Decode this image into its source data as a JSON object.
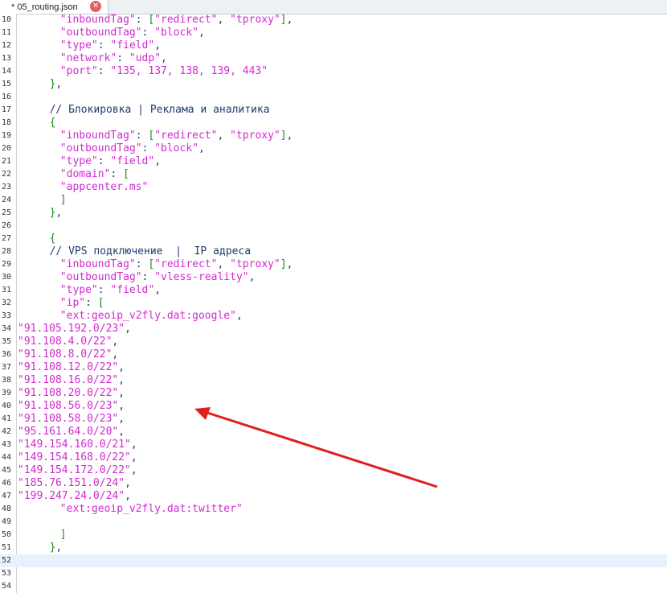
{
  "tab": {
    "title": "* 05_routing.json",
    "close_icon": "close-icon"
  },
  "lines": [
    {
      "n": "10",
      "indent": "        ",
      "tokens": [
        [
          "s",
          "\"inboundTag\""
        ],
        [
          "k",
          ": "
        ],
        [
          "p",
          "["
        ],
        [
          "s",
          "\"redirect\""
        ],
        [
          "k",
          ", "
        ],
        [
          "s",
          "\"tproxy\""
        ],
        [
          "p",
          "]"
        ],
        [
          "k",
          ","
        ]
      ]
    },
    {
      "n": "11",
      "indent": "        ",
      "tokens": [
        [
          "s",
          "\"outboundTag\""
        ],
        [
          "k",
          ": "
        ],
        [
          "s",
          "\"block\""
        ],
        [
          "k",
          ","
        ]
      ]
    },
    {
      "n": "12",
      "indent": "        ",
      "tokens": [
        [
          "s",
          "\"type\""
        ],
        [
          "k",
          ": "
        ],
        [
          "s",
          "\"field\""
        ],
        [
          "k",
          ","
        ]
      ]
    },
    {
      "n": "13",
      "indent": "        ",
      "tokens": [
        [
          "s",
          "\"network\""
        ],
        [
          "k",
          ": "
        ],
        [
          "s",
          "\"udp\""
        ],
        [
          "k",
          ","
        ]
      ]
    },
    {
      "n": "14",
      "indent": "        ",
      "tokens": [
        [
          "s",
          "\"port\""
        ],
        [
          "k",
          ": "
        ],
        [
          "s",
          "\"135, 137, 138, 139, 443\""
        ]
      ]
    },
    {
      "n": "15",
      "indent": "      ",
      "tokens": [
        [
          "p",
          "}"
        ],
        [
          "k",
          ","
        ]
      ]
    },
    {
      "n": "16",
      "indent": "",
      "tokens": []
    },
    {
      "n": "17",
      "indent": "      ",
      "tokens": [
        [
          "c",
          "// Блокировка | Реклама и аналитика"
        ]
      ]
    },
    {
      "n": "18",
      "indent": "      ",
      "tokens": [
        [
          "p",
          "{"
        ]
      ]
    },
    {
      "n": "19",
      "indent": "        ",
      "tokens": [
        [
          "s",
          "\"inboundTag\""
        ],
        [
          "k",
          ": "
        ],
        [
          "p",
          "["
        ],
        [
          "s",
          "\"redirect\""
        ],
        [
          "k",
          ", "
        ],
        [
          "s",
          "\"tproxy\""
        ],
        [
          "p",
          "]"
        ],
        [
          "k",
          ","
        ]
      ]
    },
    {
      "n": "20",
      "indent": "        ",
      "tokens": [
        [
          "s",
          "\"outboundTag\""
        ],
        [
          "k",
          ": "
        ],
        [
          "s",
          "\"block\""
        ],
        [
          "k",
          ","
        ]
      ]
    },
    {
      "n": "21",
      "indent": "        ",
      "tokens": [
        [
          "s",
          "\"type\""
        ],
        [
          "k",
          ": "
        ],
        [
          "s",
          "\"field\""
        ],
        [
          "k",
          ","
        ]
      ]
    },
    {
      "n": "22",
      "indent": "        ",
      "tokens": [
        [
          "s",
          "\"domain\""
        ],
        [
          "k",
          ": "
        ],
        [
          "p",
          "["
        ]
      ]
    },
    {
      "n": "23",
      "indent": "        ",
      "tokens": [
        [
          "s",
          "\"appcenter.ms\""
        ]
      ]
    },
    {
      "n": "24",
      "indent": "        ",
      "tokens": [
        [
          "p",
          "]"
        ]
      ]
    },
    {
      "n": "25",
      "indent": "      ",
      "tokens": [
        [
          "p",
          "}"
        ],
        [
          "k",
          ","
        ]
      ]
    },
    {
      "n": "26",
      "indent": "",
      "tokens": []
    },
    {
      "n": "27",
      "indent": "      ",
      "tokens": [
        [
          "p",
          "{"
        ]
      ]
    },
    {
      "n": "28",
      "indent": "      ",
      "tokens": [
        [
          "c",
          "// VPS подключение  |  IP адреса"
        ]
      ]
    },
    {
      "n": "29",
      "indent": "        ",
      "tokens": [
        [
          "s",
          "\"inboundTag\""
        ],
        [
          "k",
          ": "
        ],
        [
          "p",
          "["
        ],
        [
          "s",
          "\"redirect\""
        ],
        [
          "k",
          ", "
        ],
        [
          "s",
          "\"tproxy\""
        ],
        [
          "p",
          "]"
        ],
        [
          "k",
          ","
        ]
      ]
    },
    {
      "n": "30",
      "indent": "        ",
      "tokens": [
        [
          "s",
          "\"outboundTag\""
        ],
        [
          "k",
          ": "
        ],
        [
          "s",
          "\"vless-reality\""
        ],
        [
          "k",
          ","
        ]
      ]
    },
    {
      "n": "31",
      "indent": "        ",
      "tokens": [
        [
          "s",
          "\"type\""
        ],
        [
          "k",
          ": "
        ],
        [
          "s",
          "\"field\""
        ],
        [
          "k",
          ","
        ]
      ]
    },
    {
      "n": "32",
      "indent": "        ",
      "tokens": [
        [
          "s",
          "\"ip\""
        ],
        [
          "k",
          ": "
        ],
        [
          "p",
          "["
        ]
      ]
    },
    {
      "n": "33",
      "indent": "        ",
      "tokens": [
        [
          "s",
          "\"ext:geoip_v2fly.dat:google\""
        ],
        [
          "k",
          ","
        ]
      ]
    },
    {
      "n": "34",
      "indent": "",
      "tokens": [
        [
          "s",
          "\"91.105.192.0/23\""
        ],
        [
          "k",
          ","
        ]
      ]
    },
    {
      "n": "35",
      "indent": "",
      "tokens": [
        [
          "s",
          "\"91.108.4.0/22\""
        ],
        [
          "k",
          ","
        ]
      ]
    },
    {
      "n": "36",
      "indent": "",
      "tokens": [
        [
          "s",
          "\"91.108.8.0/22\""
        ],
        [
          "k",
          ","
        ]
      ]
    },
    {
      "n": "37",
      "indent": "",
      "tokens": [
        [
          "s",
          "\"91.108.12.0/22\""
        ],
        [
          "k",
          ","
        ]
      ]
    },
    {
      "n": "38",
      "indent": "",
      "tokens": [
        [
          "s",
          "\"91.108.16.0/22\""
        ],
        [
          "k",
          ","
        ]
      ]
    },
    {
      "n": "39",
      "indent": "",
      "tokens": [
        [
          "s",
          "\"91.108.20.0/22\""
        ],
        [
          "k",
          ","
        ]
      ]
    },
    {
      "n": "40",
      "indent": "",
      "tokens": [
        [
          "s",
          "\"91.108.56.0/23\""
        ],
        [
          "k",
          ","
        ]
      ]
    },
    {
      "n": "41",
      "indent": "",
      "tokens": [
        [
          "s",
          "\"91.108.58.0/23\""
        ],
        [
          "k",
          ","
        ]
      ]
    },
    {
      "n": "42",
      "indent": "",
      "tokens": [
        [
          "s",
          "\"95.161.64.0/20\""
        ],
        [
          "k",
          ","
        ]
      ]
    },
    {
      "n": "43",
      "indent": "",
      "tokens": [
        [
          "s",
          "\"149.154.160.0/21\""
        ],
        [
          "k",
          ","
        ]
      ]
    },
    {
      "n": "44",
      "indent": "",
      "tokens": [
        [
          "s",
          "\"149.154.168.0/22\""
        ],
        [
          "k",
          ","
        ]
      ]
    },
    {
      "n": "45",
      "indent": "",
      "tokens": [
        [
          "s",
          "\"149.154.172.0/22\""
        ],
        [
          "k",
          ","
        ]
      ]
    },
    {
      "n": "46",
      "indent": "",
      "tokens": [
        [
          "s",
          "\"185.76.151.0/24\""
        ],
        [
          "k",
          ","
        ]
      ]
    },
    {
      "n": "47",
      "indent": "",
      "tokens": [
        [
          "s",
          "\"199.247.24.0/24\""
        ],
        [
          "k",
          ","
        ]
      ]
    },
    {
      "n": "48",
      "indent": "        ",
      "tokens": [
        [
          "s",
          "\"ext:geoip_v2fly.dat:twitter\""
        ]
      ]
    },
    {
      "n": "49",
      "indent": "",
      "tokens": []
    },
    {
      "n": "50",
      "indent": "        ",
      "tokens": [
        [
          "p",
          "]"
        ]
      ]
    },
    {
      "n": "51",
      "indent": "      ",
      "tokens": [
        [
          "p",
          "}"
        ],
        [
          "k",
          ","
        ]
      ]
    },
    {
      "n": "52",
      "indent": "",
      "tokens": [],
      "current": true
    },
    {
      "n": "53",
      "indent": "",
      "tokens": []
    },
    {
      "n": "54",
      "indent": "",
      "tokens": []
    }
  ],
  "annotation": {
    "arrow_color": "#e0201e"
  },
  "colors": {
    "string": "#d12ad1",
    "punct": "#1a8a1a",
    "plain": "#1f3d6b",
    "current_line": "#e8f2fe"
  }
}
